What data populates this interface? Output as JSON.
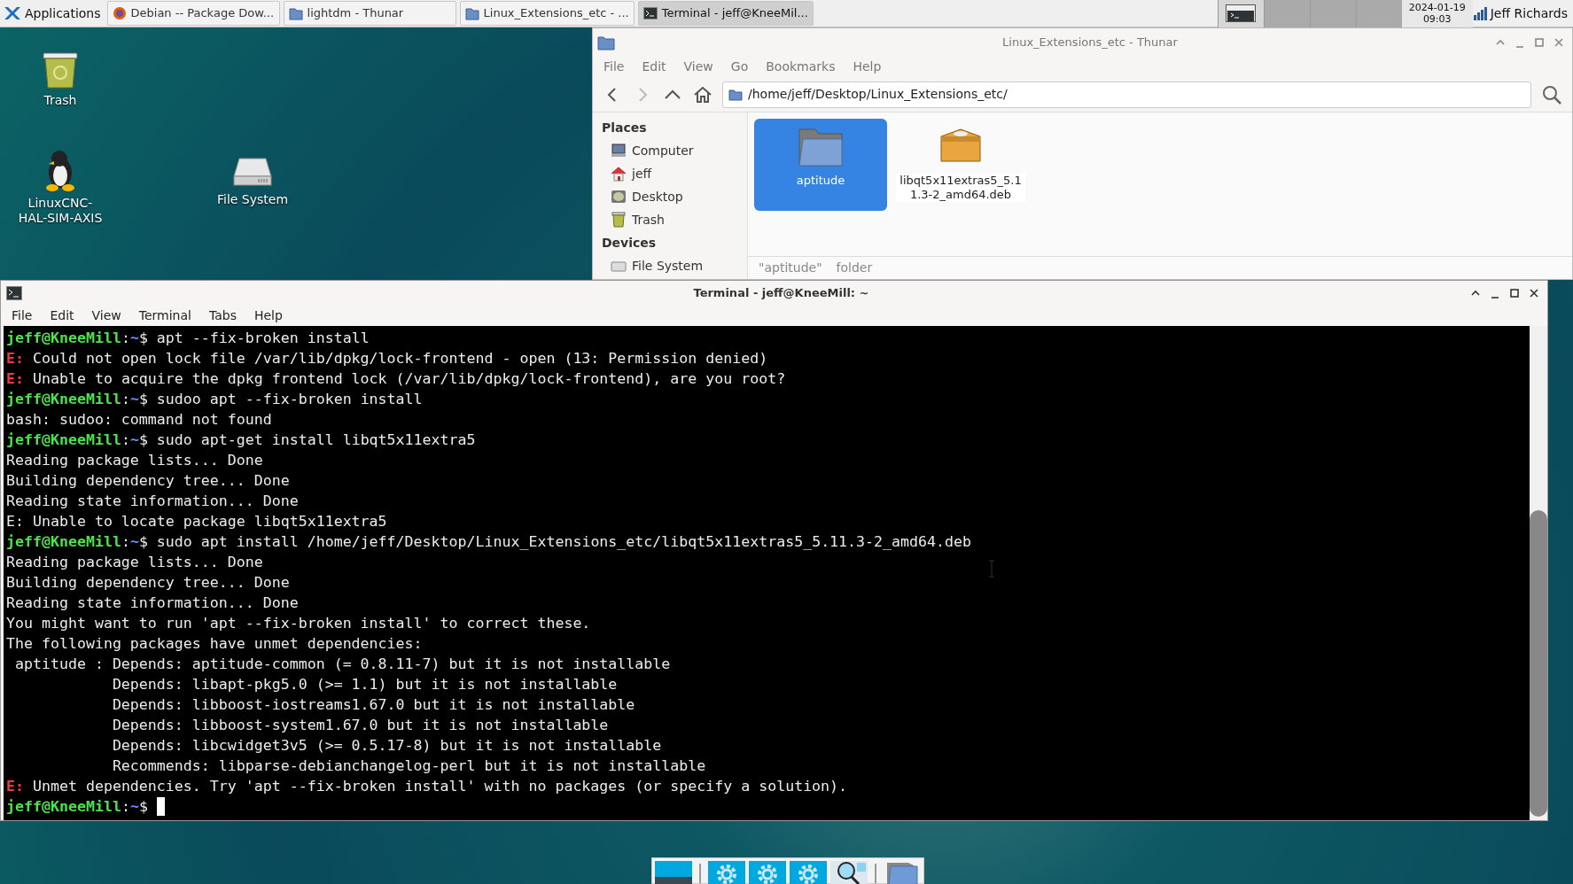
{
  "taskbar": {
    "menu_label": "Applications",
    "tasks": [
      {
        "label": "Debian -- Package Dow...",
        "kind": "browser",
        "selected": false
      },
      {
        "label": "lightdm - Thunar",
        "kind": "folder",
        "selected": false
      },
      {
        "label": "Linux_Extensions_etc - ...",
        "kind": "folder",
        "selected": false
      },
      {
        "label": "Terminal - jeff@KneeMil...",
        "kind": "terminal",
        "selected": true
      }
    ],
    "workspaces": [
      {
        "selected": true
      },
      {
        "selected": false
      },
      {
        "selected": false
      },
      {
        "selected": false
      }
    ],
    "clock": {
      "date": "2024-01-19",
      "time": "09:03"
    },
    "user": "Jeff Richards"
  },
  "desktop_icons": [
    {
      "label": "Trash",
      "kind": "trash"
    },
    {
      "label": "LinuxCNC-HAL-SIM-AXIS",
      "kind": "penguin"
    },
    {
      "label": "File System",
      "kind": "drive"
    }
  ],
  "file_manager": {
    "title": "Linux_Extensions_etc - Thunar",
    "menu": [
      "File",
      "Edit",
      "View",
      "Go",
      "Bookmarks",
      "Help"
    ],
    "path": "/home/jeff/Desktop/Linux_Extensions_etc/",
    "sections": [
      {
        "heading": "Places",
        "items": [
          {
            "label": "Computer",
            "kind": "computer"
          },
          {
            "label": "jeff",
            "kind": "home"
          },
          {
            "label": "Desktop",
            "kind": "desktop"
          },
          {
            "label": "Trash",
            "kind": "trash"
          }
        ]
      },
      {
        "heading": "Devices",
        "items": [
          {
            "label": "File System",
            "kind": "drive"
          }
        ]
      }
    ],
    "files": [
      {
        "name": "aptitude",
        "kind": "folder",
        "selected": true
      },
      {
        "name": "libqt5x11extras5_5.11.3-2_amd64.deb",
        "kind": "package",
        "selected": false
      }
    ],
    "status": [
      "\"aptitude\"",
      "folder"
    ]
  },
  "terminal": {
    "title": "Terminal - jeff@KneeMill: ~",
    "menu": [
      "File",
      "Edit",
      "View",
      "Terminal",
      "Tabs",
      "Help"
    ],
    "cursor_visible": true,
    "lines": [
      [
        {
          "kind": "user",
          "text": "jeff@KneeMill"
        },
        {
          "kind": "plain",
          "text": ":"
        },
        {
          "kind": "path",
          "text": "~"
        },
        {
          "kind": "plain",
          "text": "$ apt --fix-broken install"
        }
      ],
      [
        {
          "kind": "error",
          "text": "E:"
        },
        {
          "kind": "plain",
          "text": " Could not open lock file /var/lib/dpkg/lock-frontend - open (13: Permission denied)"
        }
      ],
      [
        {
          "kind": "error",
          "text": "E:"
        },
        {
          "kind": "plain",
          "text": " Unable to acquire the dpkg frontend lock (/var/lib/dpkg/lock-frontend), are you root?"
        }
      ],
      [
        {
          "kind": "user",
          "text": "jeff@KneeMill"
        },
        {
          "kind": "plain",
          "text": ":"
        },
        {
          "kind": "path",
          "text": "~"
        },
        {
          "kind": "plain",
          "text": "$ sudoo apt --fix-broken install"
        }
      ],
      [
        {
          "kind": "plain",
          "text": "bash: sudoo: command not found"
        }
      ],
      [
        {
          "kind": "user",
          "text": "jeff@KneeMill"
        },
        {
          "kind": "plain",
          "text": ":"
        },
        {
          "kind": "path",
          "text": "~"
        },
        {
          "kind": "plain",
          "text": "$ sudo apt-get install libqt5x11extra5"
        }
      ],
      [
        {
          "kind": "plain",
          "text": "Reading package lists... Done"
        }
      ],
      [
        {
          "kind": "plain",
          "text": "Building dependency tree... Done"
        }
      ],
      [
        {
          "kind": "plain",
          "text": "Reading state information... Done"
        }
      ],
      [
        {
          "kind": "plain",
          "text": "E: Unable to locate package libqt5x11extra5"
        }
      ],
      [
        {
          "kind": "user",
          "text": "jeff@KneeMill"
        },
        {
          "kind": "plain",
          "text": ":"
        },
        {
          "kind": "path",
          "text": "~"
        },
        {
          "kind": "plain",
          "text": "$ sudo apt install /home/jeff/Desktop/Linux_Extensions_etc/libqt5x11extras5_5.11.3-2_amd64.deb"
        }
      ],
      [
        {
          "kind": "plain",
          "text": "Reading package lists... Done"
        }
      ],
      [
        {
          "kind": "plain",
          "text": "Building dependency tree... Done"
        }
      ],
      [
        {
          "kind": "plain",
          "text": "Reading state information... Done"
        }
      ],
      [
        {
          "kind": "plain",
          "text": "You might want to run 'apt --fix-broken install' to correct these."
        }
      ],
      [
        {
          "kind": "plain",
          "text": "The following packages have unmet dependencies:"
        }
      ],
      [
        {
          "kind": "plain",
          "text": " aptitude : Depends: aptitude-common (= 0.8.11-7) but it is not installable"
        }
      ],
      [
        {
          "kind": "plain",
          "text": "            Depends: libapt-pkg5.0 (>= 1.1) but it is not installable"
        }
      ],
      [
        {
          "kind": "plain",
          "text": "            Depends: libboost-iostreams1.67.0 but it is not installable"
        }
      ],
      [
        {
          "kind": "plain",
          "text": "            Depends: libboost-system1.67.0 but it is not installable"
        }
      ],
      [
        {
          "kind": "plain",
          "text": "            Depends: libcwidget3v5 (>= 0.5.17-8) but it is not installable"
        }
      ],
      [
        {
          "kind": "plain",
          "text": "            Recommends: libparse-debianchangelog-perl but it is not installable"
        }
      ],
      [
        {
          "kind": "error",
          "text": "E:"
        },
        {
          "kind": "plain",
          "text": " Unmet dependencies. Try 'apt --fix-broken install' with no packages (or specify a solution)."
        }
      ],
      [
        {
          "kind": "user",
          "text": "jeff@KneeMill"
        },
        {
          "kind": "plain",
          "text": ":"
        },
        {
          "kind": "path",
          "text": "~"
        },
        {
          "kind": "plain",
          "text": "$ "
        }
      ]
    ]
  },
  "dock": [
    {
      "kind": "terminal"
    },
    {
      "kind": "separator"
    },
    {
      "kind": "settings"
    },
    {
      "kind": "settings"
    },
    {
      "kind": "settings"
    },
    {
      "kind": "search"
    },
    {
      "kind": "separator"
    },
    {
      "kind": "files"
    }
  ]
}
